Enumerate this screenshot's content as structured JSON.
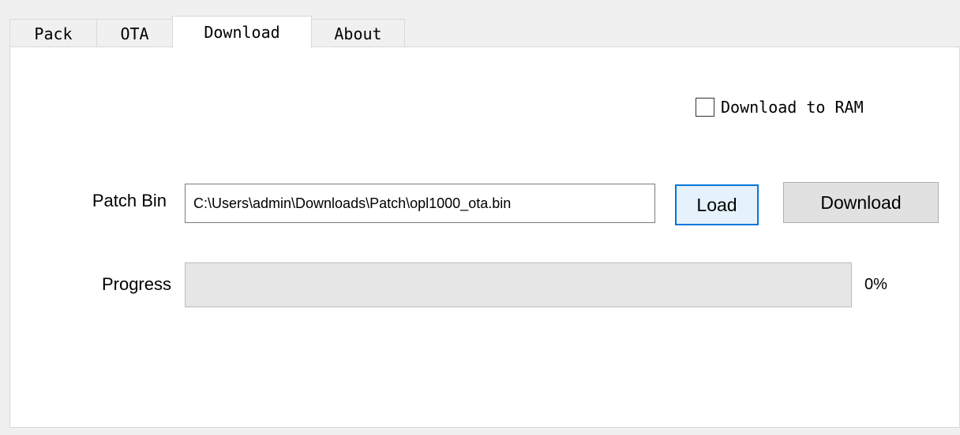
{
  "tabs": [
    {
      "label": "Pack",
      "active": false
    },
    {
      "label": "OTA",
      "active": false
    },
    {
      "label": "Download",
      "active": true
    },
    {
      "label": "About",
      "active": false
    }
  ],
  "download": {
    "ram_checkbox": {
      "label": "Download to RAM",
      "checked": false
    },
    "patch_bin_label": "Patch Bin",
    "patch_bin_value": "C:\\Users\\admin\\Downloads\\Patch\\opl1000_ota.bin",
    "load_label": "Load",
    "download_label": "Download",
    "progress_label": "Progress",
    "progress_value": 0,
    "progress_text": "0%"
  },
  "colors": {
    "focus_border": "#0078d7",
    "progress_fill": "#06b025"
  }
}
